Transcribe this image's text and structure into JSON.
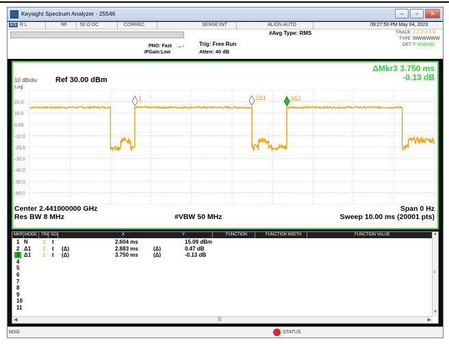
{
  "window": {
    "title": "Keysight Spectrum Analyzer - 25546",
    "min_label": "–",
    "max_label": "▫",
    "close_label": "✕"
  },
  "status": {
    "rl": "R L",
    "rf": "RF",
    "ohm": "50 Ω   DC",
    "correc": "CORREC",
    "sense": "SENSE:INT",
    "align": "ALIGN AUTO",
    "datetime": "09:27:50 PM May 04, 2023",
    "avg_type": "#Avg Type: RMS",
    "pno": "PNO: Fast",
    "ifgain": "IFGain:Low",
    "trig": "Trig: Free Run",
    "atten": "Atten: 40 dB",
    "trace_label": "TRACE",
    "trace_vals": "1 2 3 4 5 6",
    "type_label": "TYPE",
    "type_vals": "WWWWWW",
    "det_label": "DET",
    "det_vals": "P NNNNN"
  },
  "screen": {
    "marker_readout_1": "ΔMkr3 3.750 ms",
    "marker_readout_2": "-0.13 dB",
    "scale": "10 dB/div",
    "log": "Log",
    "ref": "Ref 30.00 dBm",
    "center": "Center 2.441000000 GHz",
    "span": "Span 0 Hz",
    "res_bw": "Res BW 8 MHz",
    "vbw": "#VBW 50 MHz",
    "sweep": "Sweep  10.00 ms (20001 pts)"
  },
  "chart_data": {
    "type": "line",
    "xlabel": "",
    "ylabel": "",
    "xlim": [
      0,
      10
    ],
    "ylim": [
      -70,
      30
    ],
    "y_ticks": [
      "20.0",
      "10.0",
      "0.00",
      "-10.0",
      "-20.0",
      "-30.0",
      "-40.0",
      "-50.0",
      "-60.0"
    ],
    "grid": true,
    "series": [
      {
        "x": [
          0.0,
          2.0,
          2.0,
          2.25,
          2.25,
          2.5,
          2.5,
          2.6,
          2.6,
          5.49,
          5.49,
          5.65,
          5.65,
          5.9,
          5.9,
          6.35,
          6.35,
          9.2,
          9.2,
          9.35,
          9.35,
          10.0
        ],
        "y": [
          15.0,
          15.0,
          -20.0,
          -20.0,
          -14.0,
          -14.0,
          -20.0,
          -20.0,
          15.0,
          15.0,
          -20.0,
          -20.0,
          -14.0,
          -14.0,
          -20.0,
          -20.0,
          15.0,
          15.0,
          -20.0,
          -20.0,
          -14.0,
          -14.0
        ]
      }
    ],
    "markers": [
      {
        "label": "1",
        "x": 2.604,
        "y": 15.09
      },
      {
        "label": "2Δ1",
        "x": 5.487,
        "y": 15.56
      },
      {
        "label": "3Δ1",
        "x": 6.354,
        "y": 14.96
      }
    ]
  },
  "table": {
    "headers": [
      "MKR",
      "MODE",
      "TRC",
      "SCL",
      "X",
      "Y",
      "FUNCTION",
      "FUNCTION WIDTH",
      "FUNCTION VALUE"
    ],
    "rows": [
      {
        "mkr": "1",
        "mode": "N",
        "trc": "1",
        "scl": "t",
        "delta": "",
        "x": "2.604 ms",
        "ydelta": "",
        "y": "15.09 dBm"
      },
      {
        "mkr": "2",
        "mode": "Δ1",
        "trc": "1",
        "scl": "t",
        "delta": "(Δ)",
        "x": "2.883 ms",
        "ydelta": "(Δ)",
        "y": "0.47 dB"
      },
      {
        "mkr": "3",
        "mode": "Δ1",
        "trc": "1",
        "scl": "t",
        "delta": "(Δ)",
        "x": "3.750 ms",
        "ydelta": "(Δ)",
        "y": "-0.13 dB"
      },
      {
        "mkr": "4"
      },
      {
        "mkr": "5"
      },
      {
        "mkr": "6"
      },
      {
        "mkr": "7"
      },
      {
        "mkr": "8"
      },
      {
        "mkr": "9"
      },
      {
        "mkr": "10"
      },
      {
        "mkr": "11"
      }
    ]
  },
  "footer": {
    "msg": "MSG",
    "status": "STATUS"
  },
  "colors": {
    "trace": "#f0a000",
    "screen_border": "#48d148",
    "marker_readout": "#2fcf2f",
    "grid": "#c9c9c9"
  }
}
